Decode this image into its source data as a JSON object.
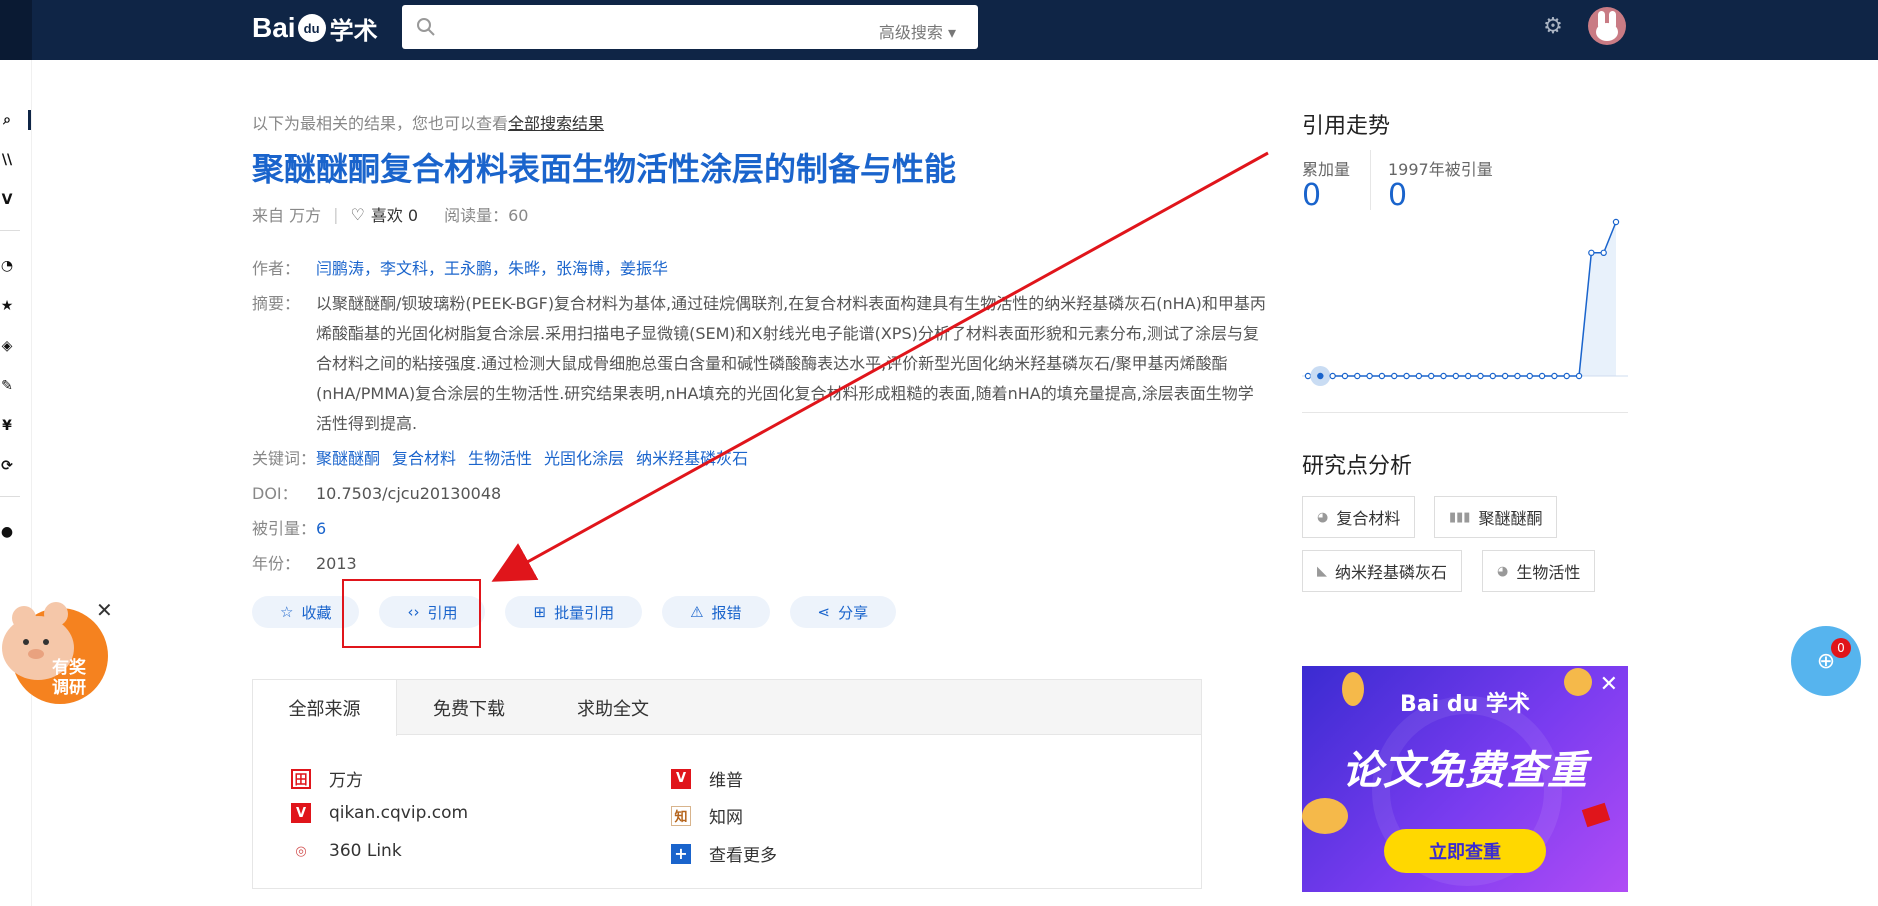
{
  "header": {
    "logo_prefix": "Bai",
    "logo_paw": "du",
    "logo_suffix": "学术",
    "search_value": "",
    "advanced_search": "高级搜索 ▾",
    "gear_icon": "gear-icon"
  },
  "result": {
    "hint_prefix": "以下为最相关的结果，您也可以查看",
    "hint_link": "全部搜索结果",
    "title": "聚醚醚酮复合材料表面生物活性涂层的制备与性能",
    "source": "来自 万方",
    "likes": "喜欢 0",
    "reads": "阅读量：60",
    "authors_label": "作者：",
    "authors": "闫鹏涛，李文科，王永鹏，朱晔，张海博，姜振华",
    "abstract_label": "摘要：",
    "abstract": "以聚醚醚酮/钡玻璃粉(PEEK-BGF)复合材料为基体,通过硅烷偶联剂,在复合材料表面构建具有生物活性的纳米羟基磷灰石(nHA)和甲基丙烯酸酯基的光固化树脂复合涂层.采用扫描电子显微镜(SEM)和X射线光电子能谱(XPS)分析了材料表面形貌和元素分布,测试了涂层与复合材料之间的粘接强度.通过检测大鼠成骨细胞总蛋白含量和碱性磷酸酶表达水平,评价新型光固化纳米羟基磷灰石/聚甲基丙烯酸酯(nHA/PMMA)复合涂层的生物活性.研究结果表明,nHA填充的光固化复合材料形成粗糙的表面,随着nHA的填充量提高,涂层表面生物学活性得到提高.",
    "keywords_label": "关键词：",
    "keywords": [
      "聚醚醚酮",
      "复合材料",
      "生物活性",
      "光固化涂层",
      "纳米羟基磷灰石"
    ],
    "doi_label": "DOI：",
    "doi": "10.7503/cjcu20130048",
    "cited_label": "被引量：",
    "cited": "6",
    "year_label": "年份：",
    "year": "2013"
  },
  "actions": [
    {
      "label": "收藏",
      "icon": "☆"
    },
    {
      "label": "引用",
      "icon": "‹›"
    },
    {
      "label": "批量引用",
      "icon": "⊞"
    },
    {
      "label": "报错",
      "icon": "⚠"
    },
    {
      "label": "分享",
      "icon": "⋖"
    }
  ],
  "sources": {
    "tabs": [
      "全部来源",
      "免费下载",
      "求助全文"
    ],
    "items": [
      {
        "name": "万方",
        "icon": "田",
        "color": "#e0151b"
      },
      {
        "name": "维普",
        "icon": "V",
        "color": "#e0151b"
      },
      {
        "name": "qikan.cqvip.com",
        "icon": "V",
        "color": "#e0151b"
      },
      {
        "name": "知网",
        "icon": "知",
        "color": "#b5651d"
      },
      {
        "name": "360 Link",
        "icon": "◎",
        "color": "#d25050"
      },
      {
        "name": "查看更多",
        "icon": "+",
        "color": "#1a64cc"
      }
    ]
  },
  "trend": {
    "heading": "引用走势",
    "cumulative_label": "累加量",
    "cumulative_value": "0",
    "year_label": "1997年被引量",
    "year_value": "0"
  },
  "chart_data": {
    "type": "line",
    "values": [
      0,
      0,
      0,
      0,
      0,
      0,
      0,
      0,
      0,
      0,
      0,
      0,
      0,
      0,
      0,
      0,
      0,
      0,
      0,
      0,
      0,
      0,
      0,
      4,
      4,
      5
    ],
    "color": "#1a64cc"
  },
  "research": {
    "heading": "研究点分析",
    "chips": [
      "复合材料",
      "聚醚醚酮",
      "纳米羟基磷灰石",
      "生物活性"
    ]
  },
  "ad": {
    "logo": "Bai du 学术",
    "title": "论文免费查重",
    "button": "立即查重"
  },
  "mascot": {
    "line1": "有奖",
    "line2": "调研"
  },
  "float_badge": "0"
}
